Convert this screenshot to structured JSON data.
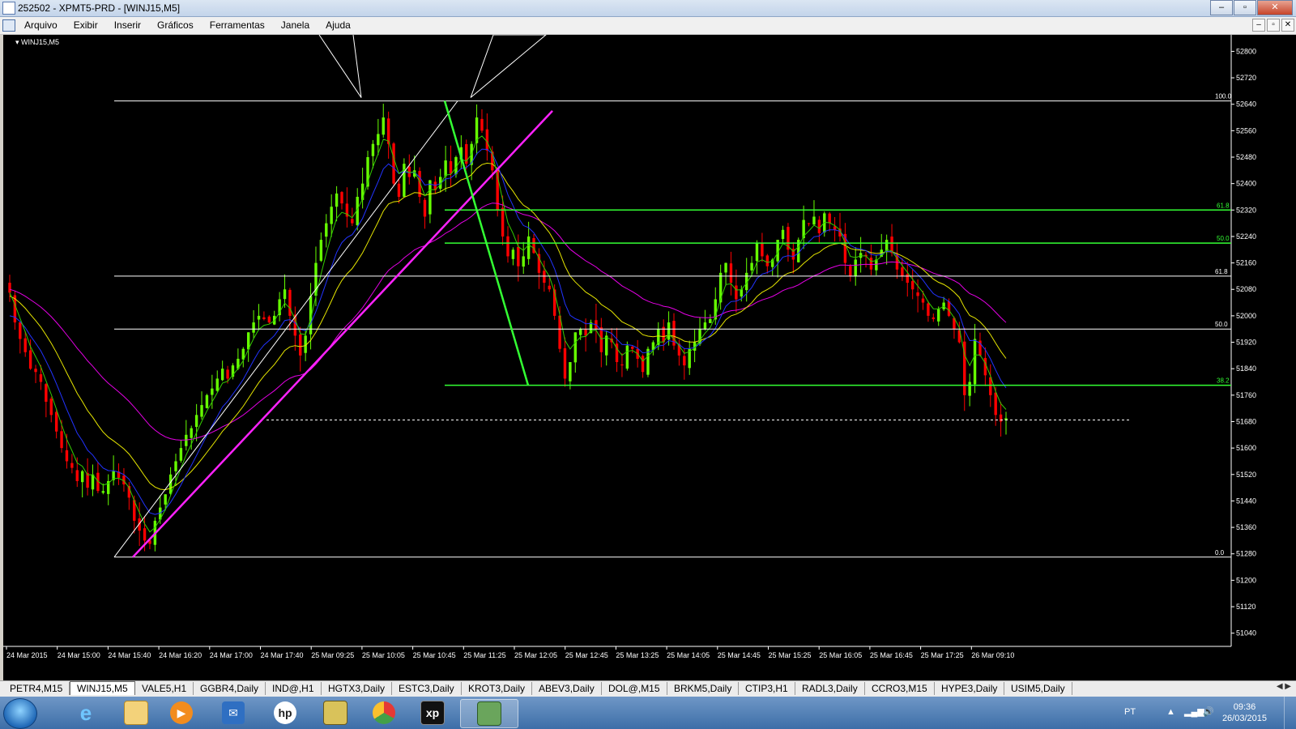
{
  "window": {
    "title": "252502 - XPMT5-PRD - [WINJ15,M5]",
    "controls": [
      "minimize",
      "maximize",
      "close"
    ]
  },
  "menu": [
    "Arquivo",
    "Exibir",
    "Inserir",
    "Gráficos",
    "Ferramentas",
    "Janela",
    "Ajuda"
  ],
  "chart_label": "WINJ15,M5",
  "chart_data": {
    "type": "candlestick",
    "symbol": "WINJ15",
    "timeframe": "M5",
    "ylim": [
      51000,
      52850
    ],
    "y_ticks": [
      52800,
      52720,
      52640,
      52560,
      52480,
      52400,
      52320,
      52240,
      52160,
      52080,
      52000,
      51920,
      51840,
      51760,
      51680,
      51600,
      51520,
      51440,
      51360,
      51280,
      51200,
      51120,
      51040
    ],
    "x_ticks": [
      "24 Mar 2015",
      "24 Mar 15:00",
      "24 Mar 15:40",
      "24 Mar 16:20",
      "24 Mar 17:00",
      "24 Mar 17:40",
      "25 Mar 09:25",
      "25 Mar 10:05",
      "25 Mar 10:45",
      "25 Mar 11:25",
      "25 Mar 12:05",
      "25 Mar 12:45",
      "25 Mar 13:25",
      "25 Mar 14:05",
      "25 Mar 14:45",
      "25 Mar 15:25",
      "25 Mar 16:05",
      "25 Mar 16:45",
      "25 Mar 17:25",
      "26 Mar 09:10"
    ],
    "close_series": [
      52070,
      51980,
      51930,
      51890,
      51840,
      51830,
      51800,
      51740,
      51700,
      51650,
      51600,
      51560,
      51540,
      51500,
      51530,
      51480,
      51520,
      51470,
      51470,
      51500,
      51530,
      51510,
      51490,
      51450,
      51380,
      51350,
      51320,
      51310,
      51380,
      51420,
      51460,
      51520,
      51560,
      51600,
      51640,
      51660,
      51700,
      51730,
      51760,
      51780,
      51810,
      51840,
      51810,
      51850,
      51870,
      51900,
      51950,
      51980,
      52000,
      51990,
      51980,
      52000,
      52050,
      52080,
      52000,
      51940,
      51880,
      51940,
      52060,
      52160,
      52230,
      52280,
      52330,
      52370,
      52340,
      52300,
      52280,
      52360,
      52400,
      52480,
      52520,
      52550,
      52600,
      52520,
      52400,
      52360,
      52460,
      52420,
      52440,
      52360,
      52300,
      52410,
      52380,
      52420,
      52470,
      52430,
      52480,
      52510,
      52460,
      52520,
      52600,
      52560,
      52500,
      52440,
      52320,
      52240,
      52180,
      52200,
      52150,
      52180,
      52240,
      52190,
      52130,
      52100,
      52080,
      52000,
      51900,
      51810,
      51860,
      51950,
      51960,
      51940,
      51980,
      51960,
      51890,
      51940,
      51920,
      51860,
      51850,
      51910,
      51900,
      51870,
      51830,
      51900,
      51920,
      51960,
      51920,
      51980,
      51910,
      51880,
      51850,
      51900,
      51920,
      51960,
      51980,
      51990,
      52050,
      52130,
      52160,
      52100,
      52050,
      52080,
      52130,
      52160,
      52220,
      52180,
      52150,
      52170,
      52230,
      52260,
      52200,
      52170,
      52230,
      52290,
      52280,
      52300,
      52250,
      52310,
      52280,
      52260,
      52240,
      52160,
      52120,
      52170,
      52190,
      52180,
      52140,
      52170,
      52200,
      52230,
      52190,
      52140,
      52120,
      52100,
      52080,
      52060,
      52040,
      52000,
      51990,
      52020,
      52040,
      52000,
      51960,
      51920,
      51760,
      51800,
      51930,
      51880,
      51820,
      51760,
      51700,
      51680,
      51690
    ],
    "overlays": {
      "ma_green_fast": "green",
      "ma_blue": "blue",
      "ma_yellow": "yellow",
      "ma_magenta": "magenta"
    },
    "fibonacci_1": {
      "levels": [
        {
          "label": "100.0",
          "value": 52650
        },
        {
          "label": "61.8",
          "value": 52120
        },
        {
          "label": "50.0",
          "value": 51960
        },
        {
          "label": "0.0",
          "value": 51270
        }
      ]
    },
    "fibonacci_2": {
      "levels": [
        {
          "label": "61.8",
          "value": 52320
        },
        {
          "label": "50.0",
          "value": 52220
        },
        {
          "label": "38.2",
          "value": 51790
        }
      ]
    },
    "current_price_line": 51685
  },
  "tabs": [
    "PETR4,M15",
    "WINJ15,M5",
    "VALE5,H1",
    "GGBR4,Daily",
    "IND@,H1",
    "HGTX3,Daily",
    "ESTC3,Daily",
    "KROT3,Daily",
    "ABEV3,Daily",
    "DOL@,M15",
    "BRKM5,Daily",
    "CTIP3,H1",
    "RADL3,Daily",
    "CCRO3,M15",
    "HYPE3,Daily",
    "USIM5,Daily"
  ],
  "active_tab": "WINJ15,M5",
  "taskbar": {
    "apps": [
      "internet-explorer-icon",
      "file-explorer-icon",
      "media-player-icon",
      "outlook-icon",
      "hp-icon",
      "app-icon",
      "chrome-icon",
      "xp-icon",
      "metatrader-icon"
    ],
    "active_app": "metatrader-icon",
    "language": "PT",
    "time": "09:36",
    "date": "26/03/2015"
  }
}
